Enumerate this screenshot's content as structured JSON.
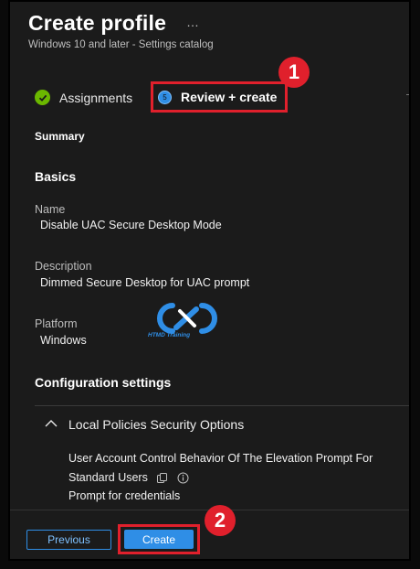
{
  "header": {
    "title": "Create profile",
    "more": "…",
    "subtitle": "Windows 10 and later - Settings catalog"
  },
  "steps": [
    {
      "label": "Assignments",
      "state": "complete"
    },
    {
      "label": "Review + create",
      "number": "5",
      "state": "current"
    }
  ],
  "annotations": {
    "badge1": "1",
    "badge2": "2",
    "color": "#e0202c"
  },
  "summary": {
    "heading": "Summary",
    "basics_heading": "Basics",
    "fields": [
      {
        "label": "Name",
        "value": "Disable UAC Secure Desktop Mode"
      },
      {
        "label": "Description",
        "value": "Dimmed Secure Desktop for UAC prompt"
      },
      {
        "label": "Platform",
        "value": "Windows"
      }
    ],
    "config_heading": "Configuration settings",
    "group": {
      "title": "Local Policies Security Options",
      "setting_name": "User Account Control Behavior Of The Elevation Prompt For Standard Users",
      "setting_value": "Prompt for credentials"
    }
  },
  "watermark": {
    "caption": "HTMD Training"
  },
  "footer": {
    "previous_label": "Previous",
    "create_label": "Create"
  },
  "colors": {
    "accent": "#2f8ee6",
    "success": "#6bb700",
    "background": "#1b1b1b"
  }
}
